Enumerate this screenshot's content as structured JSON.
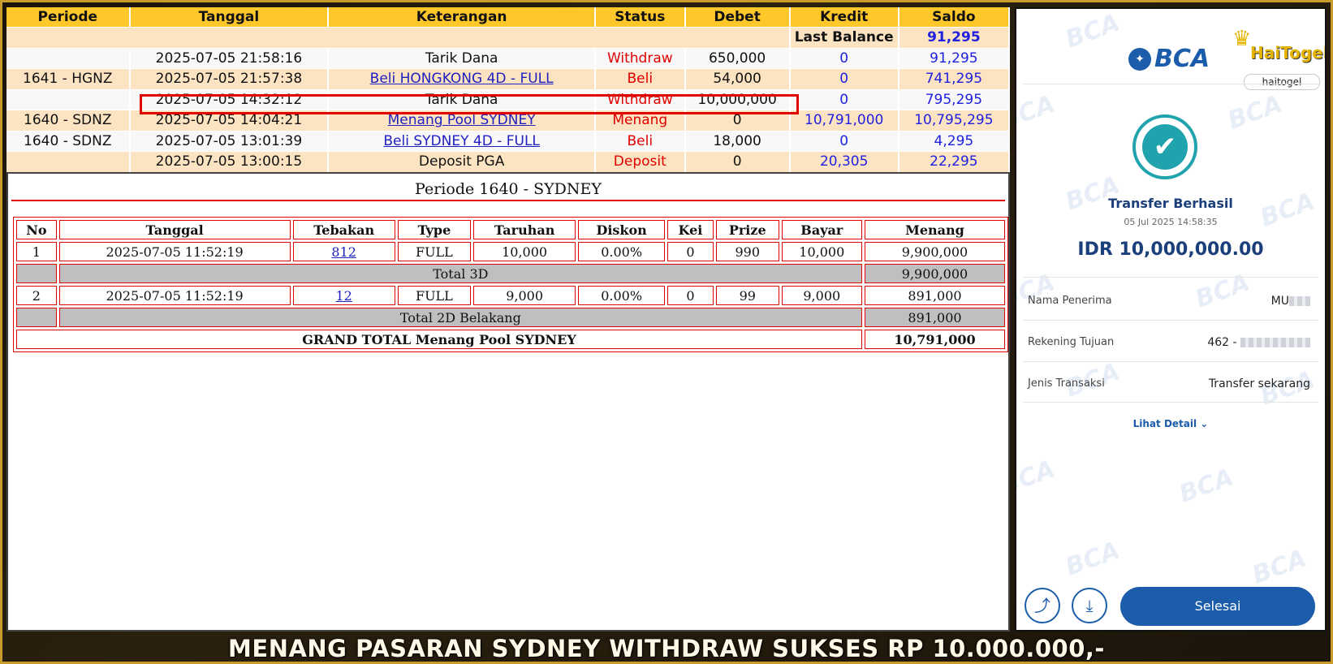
{
  "ledger": {
    "headers": [
      "Periode",
      "Tanggal",
      "Keterangan",
      "Status",
      "Debet",
      "Kredit",
      "Saldo"
    ],
    "last_balance_label": "Last Balance",
    "last_balance_value": "91,295",
    "rows": [
      {
        "periode": "",
        "tanggal": "2025-07-05 21:58:16",
        "keterangan": "Tarik Dana",
        "status": "Withdraw",
        "debet": "650,000",
        "kredit": "0",
        "saldo": "91,295"
      },
      {
        "periode": "1641 - HGNZ",
        "tanggal": "2025-07-05 21:57:38",
        "keterangan": "Beli HONGKONG 4D - FULL",
        "status": "Beli",
        "debet": "54,000",
        "kredit": "0",
        "saldo": "741,295"
      },
      {
        "periode": "",
        "tanggal": "2025-07-05 14:32:12",
        "keterangan": "Tarik Dana",
        "status": "Withdraw",
        "debet": "10,000,000",
        "kredit": "0",
        "saldo": "795,295"
      },
      {
        "periode": "1640 - SDNZ",
        "tanggal": "2025-07-05 14:04:21",
        "keterangan": "Menang Pool SYDNEY",
        "status": "Menang",
        "debet": "0",
        "kredit": "10,791,000",
        "saldo": "10,795,295"
      },
      {
        "periode": "1640 - SDNZ",
        "tanggal": "2025-07-05 13:01:39",
        "keterangan": "Beli SYDNEY 4D - FULL",
        "status": "Beli",
        "debet": "18,000",
        "kredit": "0",
        "saldo": "4,295"
      },
      {
        "periode": "",
        "tanggal": "2025-07-05 13:00:15",
        "keterangan": "Deposit PGA",
        "status": "Deposit",
        "debet": "0",
        "kredit": "20,305",
        "saldo": "22,295"
      }
    ]
  },
  "detail": {
    "title": "Periode 1640 - SYDNEY",
    "headers": [
      "No",
      "Tanggal",
      "Tebakan",
      "Type",
      "Taruhan",
      "Diskon",
      "Kei",
      "Prize",
      "Bayar",
      "Menang"
    ],
    "bets": [
      {
        "no": "1",
        "tanggal": "2025-07-05 11:52:19",
        "tebakan": "812",
        "type": "FULL",
        "taruhan": "10,000",
        "diskon": "0.00%",
        "kei": "0",
        "prize": "990",
        "bayar": "10,000",
        "menang": "9,900,000"
      },
      {
        "no": "2",
        "tanggal": "2025-07-05 11:52:19",
        "tebakan": "12",
        "type": "FULL",
        "taruhan": "9,000",
        "diskon": "0.00%",
        "kei": "0",
        "prize": "99",
        "bayar": "9,000",
        "menang": "891,000"
      }
    ],
    "total_3d_label": "Total 3D",
    "total_3d_value": "9,900,000",
    "total_2d_label": "Total 2D Belakang",
    "total_2d_value": "891,000",
    "grand_label": "GRAND TOTAL  Menang Pool SYDNEY",
    "grand_value": "10,791,000"
  },
  "receipt": {
    "bank": "BCA",
    "watermark": "BCA",
    "brand_name": "HaiTogel",
    "brand_pill": "haitogel",
    "status_title": "Transfer Berhasil",
    "datetime": "05 Jul 2025 14:58:35",
    "amount": "IDR 10,000,000.00",
    "fields": [
      {
        "label": "Nama Penerima",
        "value": "MU"
      },
      {
        "label": "Rekening Tujuan",
        "value": "462 -"
      },
      {
        "label": "Jenis Transaksi",
        "value": "Transfer sekarang"
      }
    ],
    "detail_link": "Lihat Detail",
    "done_button": "Selesai",
    "icons": [
      "share-icon",
      "download-icon",
      "check-icon",
      "chevron-down-icon"
    ]
  },
  "banner": "MENANG PASARAN SYDNEY WITHDRAW SUKSES RP 10.000.000,-",
  "colors": {
    "header": "#ffc72a",
    "row_alt": "#fce4c2",
    "red": "#e00000",
    "blue": "#2020e0",
    "bca": "#1b5cab",
    "teal": "#21a3ad",
    "gold": "#c99b2a"
  }
}
